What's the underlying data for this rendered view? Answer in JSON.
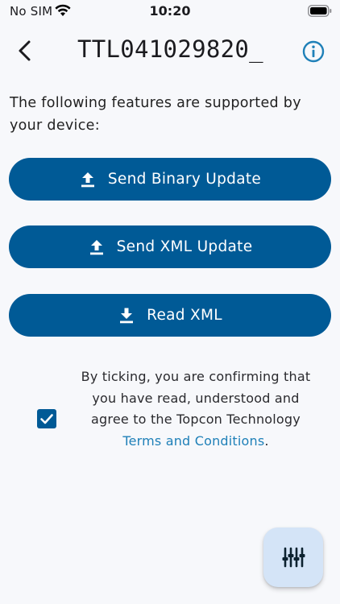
{
  "status_bar": {
    "carrier": "No SIM",
    "time": "10:20",
    "icons": [
      "wifi-icon",
      "battery-icon"
    ]
  },
  "header": {
    "back_icon": "chevron-left-icon",
    "title": "TTL041029820_",
    "info_icon": "info-circle-icon"
  },
  "intro_text": "The following features are supported by your device:",
  "actions": [
    {
      "label": "Send Binary Update",
      "icon": "upload-icon"
    },
    {
      "label": "Send XML Update",
      "icon": "upload-icon"
    },
    {
      "label": "Read XML",
      "icon": "download-icon"
    }
  ],
  "consent": {
    "checked": true,
    "text_before": "By ticking, you are confirming that you have read, understood and agree to the Topcon Technology ",
    "link_text": "Terms and Conditions",
    "text_after": "."
  },
  "fab": {
    "icon": "sliders-icon"
  },
  "colors": {
    "background": "#f7f8fb",
    "primary": "#005a96",
    "link": "#1f80b8",
    "fab_background": "#d4e4f7"
  }
}
